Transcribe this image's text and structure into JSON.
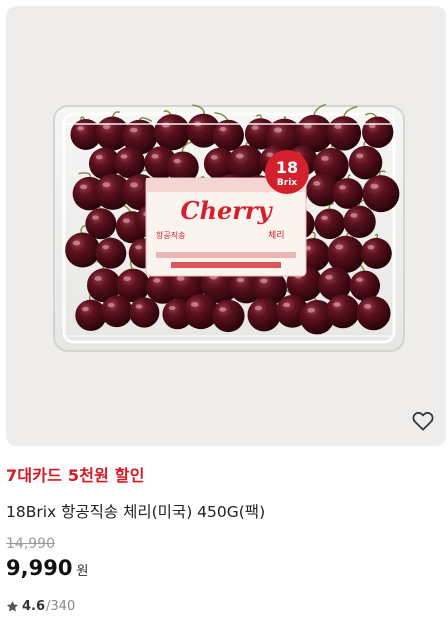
{
  "product": {
    "image": {
      "label_badge_number": "18",
      "label_badge_unit": "Brix",
      "label_brand": "Cherry",
      "label_side": "항공직송",
      "label_korean": "체리"
    },
    "wishlist_icon": "heart-outline-icon",
    "promo": "7대카드 5천원 할인",
    "title": "18Brix 항공직송 체리(미국) 450G(팩)",
    "original_price": "14,990",
    "sale_price": "9,990",
    "currency": "원",
    "rating": {
      "star_icon": "star-icon",
      "score": "4.6",
      "count": "/340"
    }
  },
  "colors": {
    "promo": "#d7191f",
    "background_thumb": "#eeedeb",
    "cherry_dark": "#4a0d17",
    "label_red": "#d4202c"
  }
}
